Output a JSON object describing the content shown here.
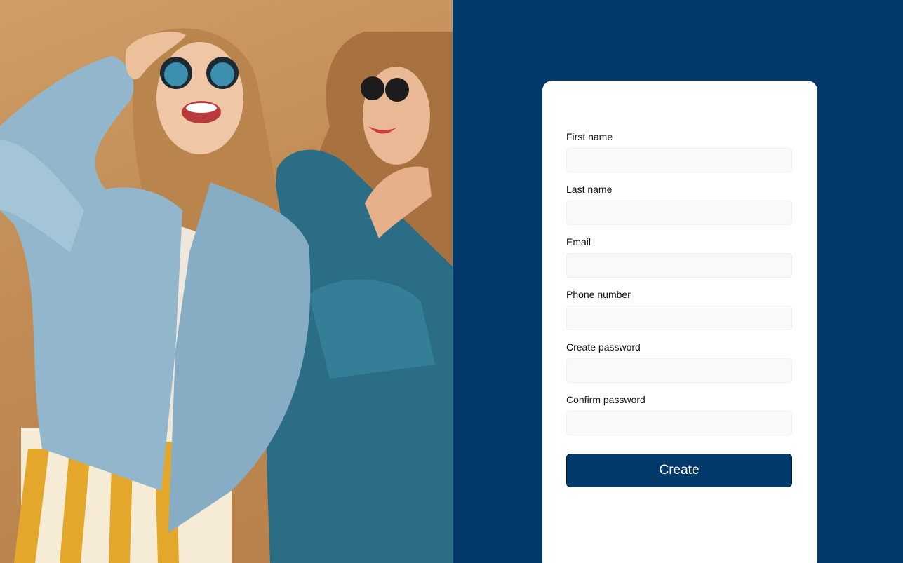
{
  "hero_image": {
    "description_icon": "photo-two-women-laughing"
  },
  "form": {
    "fields": [
      {
        "label": "First name",
        "value": "",
        "placeholder": ""
      },
      {
        "label": "Last name",
        "value": "",
        "placeholder": ""
      },
      {
        "label": "Email",
        "value": "",
        "placeholder": ""
      },
      {
        "label": "Phone number",
        "value": "",
        "placeholder": ""
      },
      {
        "label": "Create password",
        "value": "",
        "placeholder": ""
      },
      {
        "label": "Confirm password",
        "value": "",
        "placeholder": ""
      }
    ],
    "submit_label": "Create"
  },
  "colors": {
    "panel_background": "#02386a",
    "card_background": "#ffffff",
    "button_background": "#03396b",
    "button_text": "#ffffff",
    "photo_background": "#c4905a"
  }
}
